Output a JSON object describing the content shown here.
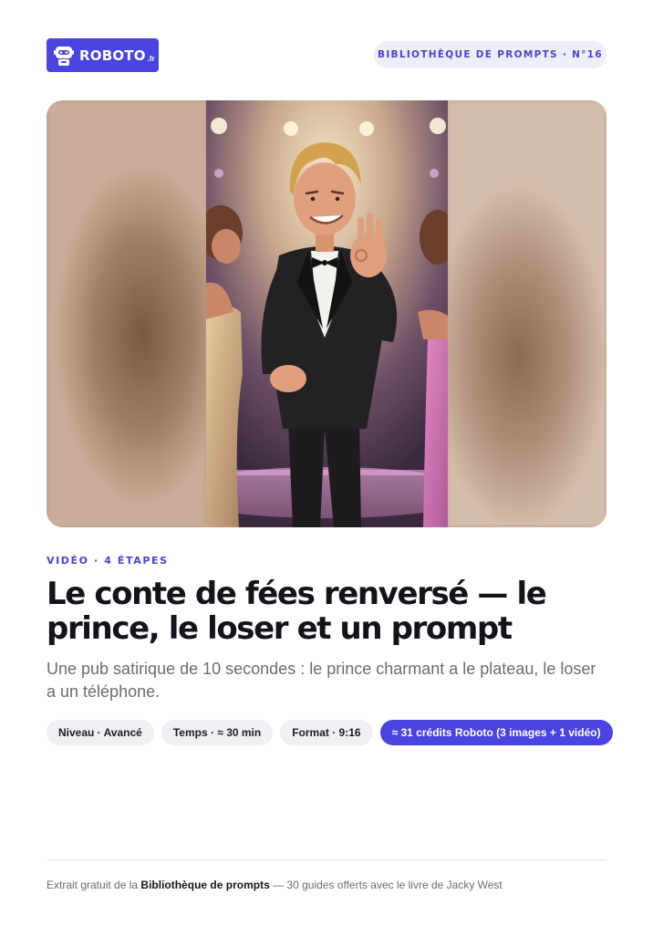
{
  "header": {
    "logo_text": "ROBOTO",
    "logo_tld": ".fr",
    "series_label": "BIBLIOTHÈQUE DE PROMPTS · N°16"
  },
  "hero": {
    "icon": "robot-icon",
    "image_subject": "cartoon prince in tuxedo giving ok sign between two women on a stage"
  },
  "article": {
    "kicker": "VIDÉO · 4 ÉTAPES",
    "title": "Le conte de fées renversé — le prince, le loser et un prompt",
    "subtitle": "Une pub satirique de 10 secondes : le prince charmant a le plateau, le loser a un téléphone."
  },
  "tags": [
    {
      "label": "Niveau · Avancé"
    },
    {
      "label": "Temps · ≈ 30 min"
    },
    {
      "label": "Format · 9:16"
    },
    {
      "label": "≈ 31 crédits Roboto (3 images + 1 vidéo)"
    }
  ],
  "footer": {
    "prefix": "Extrait gratuit de la",
    "bold": "Bibliothèque de prompts",
    "suffix": "— 30 guides offerts avec le livre de Jacky West"
  },
  "colors": {
    "accent": "#4a44e0",
    "pill_bg": "#eeeefb",
    "tag_bg": "#f0f0f4"
  }
}
